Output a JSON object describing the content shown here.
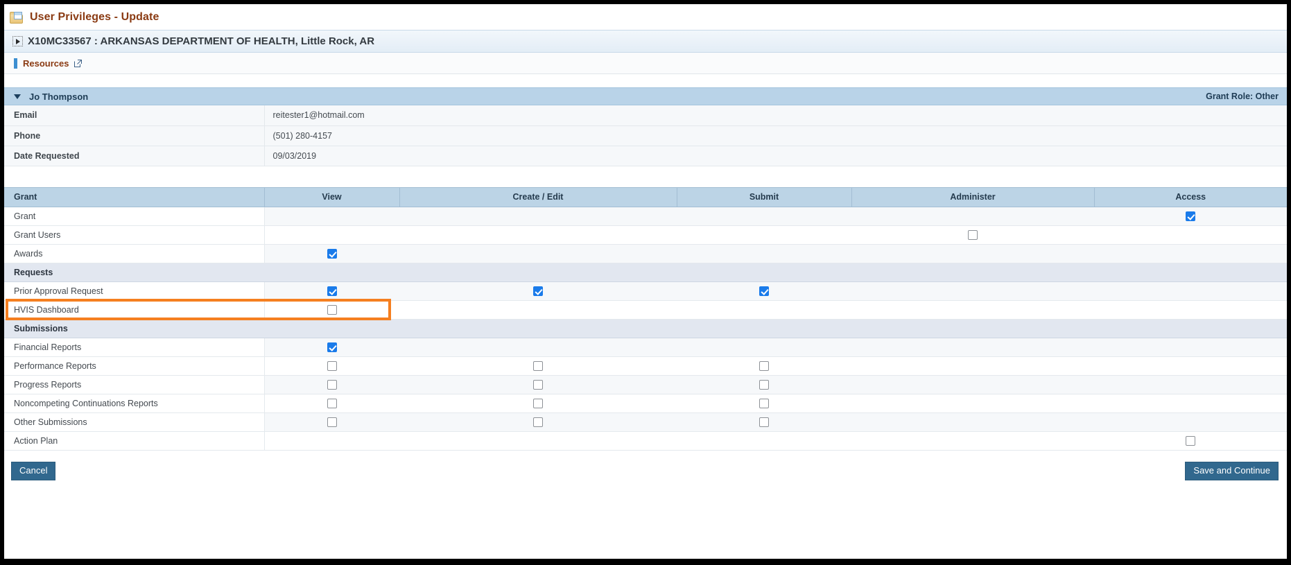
{
  "page": {
    "title": "User Privileges - Update",
    "title_icon": "folder-document-icon"
  },
  "org": {
    "text": "X10MC33567 : ARKANSAS DEPARTMENT OF HEALTH, Little Rock, AR",
    "toggle_icon": "expand-triangle-icon"
  },
  "resources": {
    "label": "Resources",
    "external_icon": "external-link-icon"
  },
  "person": {
    "name": "Jo Thompson",
    "grant_role": "Grant Role: Other",
    "collapse_icon": "caret-down-icon",
    "details": [
      {
        "label": "Email",
        "value": "reitester1@hotmail.com"
      },
      {
        "label": "Phone",
        "value": "(501) 280-4157"
      },
      {
        "label": "Date Requested",
        "value": "09/03/2019"
      }
    ]
  },
  "privileges": {
    "columns": [
      "Grant",
      "View",
      "Create / Edit",
      "Submit",
      "Administer",
      "Access"
    ],
    "rows": [
      {
        "type": "row",
        "label": "Grant",
        "view": null,
        "create_edit": null,
        "submit": null,
        "administer": null,
        "access": true
      },
      {
        "type": "row",
        "label": "Grant Users",
        "view": null,
        "create_edit": null,
        "submit": null,
        "administer": false,
        "access": null
      },
      {
        "type": "row",
        "label": "Awards",
        "view": true,
        "create_edit": null,
        "submit": null,
        "administer": null,
        "access": null
      },
      {
        "type": "group",
        "label": "Requests"
      },
      {
        "type": "row",
        "label": "Prior Approval Request",
        "view": true,
        "create_edit": true,
        "submit": true,
        "administer": null,
        "access": null
      },
      {
        "type": "row",
        "label": "HVIS Dashboard",
        "view": false,
        "create_edit": null,
        "submit": null,
        "administer": null,
        "access": null,
        "highlighted": true
      },
      {
        "type": "group",
        "label": "Submissions"
      },
      {
        "type": "row",
        "label": "Financial Reports",
        "view": true,
        "create_edit": null,
        "submit": null,
        "administer": null,
        "access": null
      },
      {
        "type": "row",
        "label": "Performance Reports",
        "view": false,
        "create_edit": false,
        "submit": false,
        "administer": null,
        "access": null
      },
      {
        "type": "row",
        "label": "Progress Reports",
        "view": false,
        "create_edit": false,
        "submit": false,
        "administer": null,
        "access": null
      },
      {
        "type": "row",
        "label": "Noncompeting Continuations Reports",
        "view": false,
        "create_edit": false,
        "submit": false,
        "administer": null,
        "access": null
      },
      {
        "type": "row",
        "label": "Other Submissions",
        "view": false,
        "create_edit": false,
        "submit": false,
        "administer": null,
        "access": null
      },
      {
        "type": "row",
        "label": "Action Plan",
        "view": null,
        "create_edit": null,
        "submit": null,
        "administer": null,
        "access": false
      }
    ]
  },
  "footer": {
    "cancel_label": "Cancel",
    "save_label": "Save and Continue"
  },
  "colors": {
    "accent_title": "#8a3a12",
    "highlight": "#f57f20",
    "checkbox_on": "#1a7bea",
    "button": "#31688e",
    "person_bar": "#b9d3e8",
    "table_header": "#bcd4e6"
  }
}
